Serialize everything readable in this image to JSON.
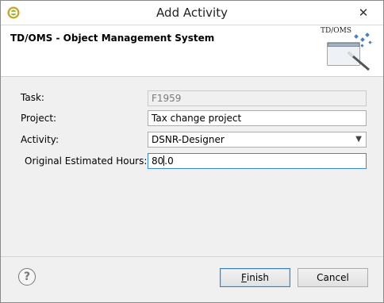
{
  "window": {
    "title": "Add Activity",
    "close_glyph": "✕",
    "app_icon": "eclipse-like-icon"
  },
  "banner": {
    "title": "TD/OMS - Object Management System",
    "logo_text": "TD/OMS"
  },
  "form": {
    "task": {
      "label": "Task:",
      "value": "F1959"
    },
    "project": {
      "label": "Project:",
      "value": "Tax change project"
    },
    "activity": {
      "label": "Activity:",
      "value": "DSNR-Designer"
    },
    "hours": {
      "label": "Original Estimated Hours:",
      "value_before_caret": "80",
      "value_after_caret": ".0"
    }
  },
  "footer": {
    "help_glyph": "?",
    "finish_first": "F",
    "finish_rest": "inish",
    "cancel_label": "Cancel"
  },
  "colors": {
    "default_button_border": "#3c7fb1",
    "focus_border": "#3b8ad9"
  }
}
